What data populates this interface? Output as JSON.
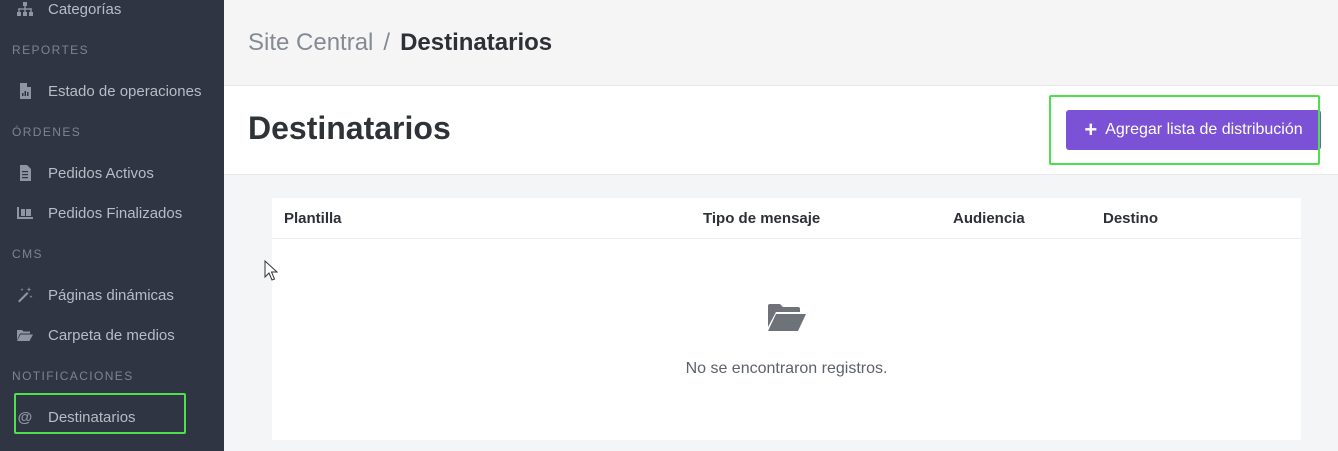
{
  "sidebar": {
    "items": [
      {
        "label": "Categorías",
        "icon": "sitemap-icon"
      },
      {
        "label": "Estado de operaciones",
        "icon": "file-chart-icon"
      },
      {
        "label": "Pedidos Activos",
        "icon": "document-icon"
      },
      {
        "label": "Pedidos Finalizados",
        "icon": "pallet-icon"
      },
      {
        "label": "Páginas dinámicas",
        "icon": "magic-wand-icon"
      },
      {
        "label": "Carpeta de medios",
        "icon": "folder-open-icon"
      },
      {
        "label": "Destinatarios",
        "icon": "at-icon"
      }
    ],
    "sections": {
      "reportes": "REPORTES",
      "ordenes": "ÓRDENES",
      "cms": "CMS",
      "notificaciones": "NOTIFICACIONES"
    },
    "active_item": "Destinatarios"
  },
  "breadcrumb": {
    "parent": "Site Central",
    "separator": "/",
    "current": "Destinatarios"
  },
  "page": {
    "title": "Destinatarios",
    "add_button_label": "Agregar lista de distribución"
  },
  "table": {
    "columns": [
      "Plantilla",
      "Tipo de mensaje",
      "Audiencia",
      "Destino"
    ],
    "rows": [],
    "empty_message": "No se encontraron registros."
  },
  "colors": {
    "sidebar_bg": "#2f3542",
    "accent": "#7b52d6",
    "highlight": "#4ce04c"
  }
}
